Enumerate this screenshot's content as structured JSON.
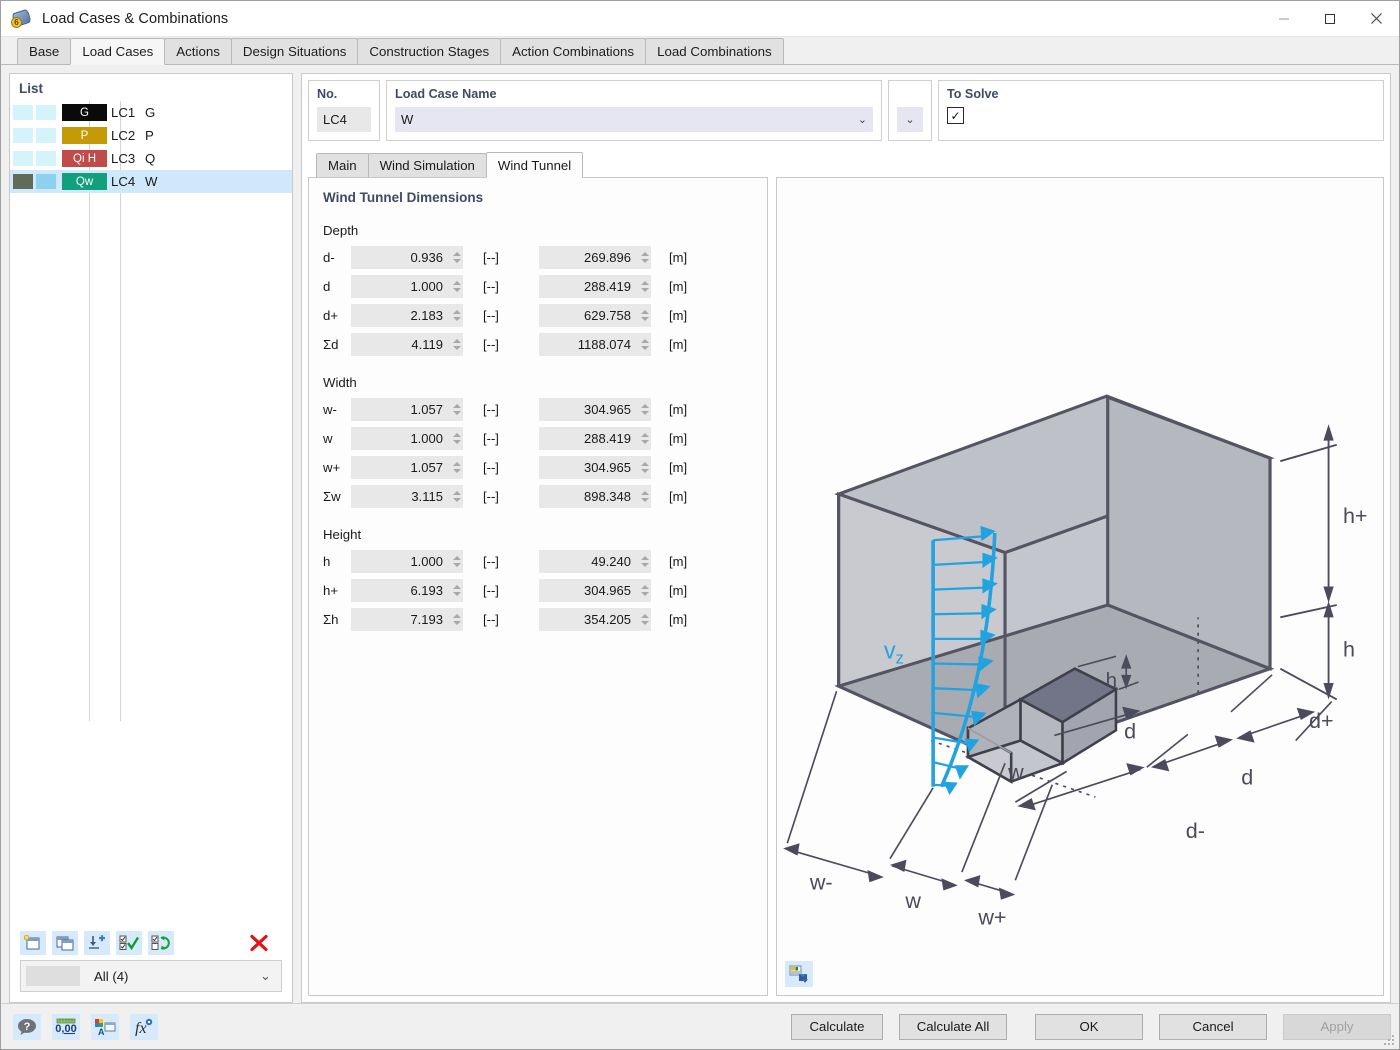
{
  "window": {
    "title": "Load Cases & Combinations",
    "icon": "load-case-icon",
    "minimize_label": "—",
    "maximize_label": "□",
    "close_label": "✕"
  },
  "tabs": [
    {
      "label": "Base",
      "active": false
    },
    {
      "label": "Load Cases",
      "active": true
    },
    {
      "label": "Actions",
      "active": false
    },
    {
      "label": "Design Situations",
      "active": false
    },
    {
      "label": "Construction Stages",
      "active": false
    },
    {
      "label": "Action Combinations",
      "active": false
    },
    {
      "label": "Load Combinations",
      "active": false
    }
  ],
  "list_panel": {
    "header": "List",
    "rows": [
      {
        "tag": "G",
        "tag_bg": "#0a0a0a",
        "no": "LC1",
        "name": "G",
        "sw1": "#d4f3fb",
        "sw2": "#d4f3fb",
        "selected": false
      },
      {
        "tag": "P",
        "tag_bg": "#c49a06",
        "no": "LC2",
        "name": "P",
        "sw1": "#d4f3fb",
        "sw2": "#d4f3fb",
        "selected": false
      },
      {
        "tag": "Qi H",
        "tag_bg": "#bf4b4b",
        "no": "LC3",
        "name": "Q",
        "sw1": "#d4f3fb",
        "sw2": "#d4f3fb",
        "selected": false
      },
      {
        "tag": "Qw",
        "tag_bg": "#12a07c",
        "no": "LC4",
        "name": "W",
        "sw1": "#606b5c",
        "sw2": "#8ed0ef",
        "selected": true
      }
    ],
    "toolbar": [
      {
        "name": "new-load-case-button",
        "title": "New"
      },
      {
        "name": "copy-load-case-button",
        "title": "Copy"
      },
      {
        "name": "import-load-case-button",
        "title": "Import"
      },
      {
        "name": "select-all-button",
        "title": "Select All"
      },
      {
        "name": "invert-selection-button",
        "title": "Invert Selection"
      },
      {
        "name": "delete-load-case-button",
        "title": "Delete"
      }
    ],
    "filter": {
      "value": "All (4)",
      "caret": "⌄"
    }
  },
  "header_fields": {
    "no": {
      "label": "No.",
      "value": "LC4"
    },
    "load_case_name": {
      "label": "Load Case Name",
      "value": "W",
      "caret": "⌄"
    },
    "mini_select": {
      "caret": "⌄"
    },
    "to_solve": {
      "label": "To Solve",
      "checked": true,
      "check_glyph": "✓"
    }
  },
  "inner_tabs": [
    {
      "label": "Main",
      "active": false
    },
    {
      "label": "Wind Simulation",
      "active": false
    },
    {
      "label": "Wind Tunnel",
      "active": true
    }
  ],
  "form": {
    "section_title": "Wind Tunnel Dimensions",
    "unit_ratio": "[--]",
    "unit_length": "[m]",
    "groups": [
      {
        "label": "Depth",
        "rows": [
          {
            "symbol": "d-",
            "ratio": "0.936",
            "length": "269.896"
          },
          {
            "symbol": "d",
            "ratio": "1.000",
            "length": "288.419"
          },
          {
            "symbol": "d+",
            "ratio": "2.183",
            "length": "629.758"
          },
          {
            "symbol": "Σd",
            "ratio": "4.119",
            "length": "1188.074"
          }
        ]
      },
      {
        "label": "Width",
        "rows": [
          {
            "symbol": "w-",
            "ratio": "1.057",
            "length": "304.965"
          },
          {
            "symbol": "w",
            "ratio": "1.000",
            "length": "288.419"
          },
          {
            "symbol": "w+",
            "ratio": "1.057",
            "length": "304.965"
          },
          {
            "symbol": "Σw",
            "ratio": "3.115",
            "length": "898.348"
          }
        ]
      },
      {
        "label": "Height",
        "rows": [
          {
            "symbol": "h",
            "ratio": "1.000",
            "length": "49.240"
          },
          {
            "symbol": "h+",
            "ratio": "6.193",
            "length": "304.965"
          },
          {
            "symbol": "Σh",
            "ratio": "7.193",
            "length": "354.205"
          }
        ]
      }
    ]
  },
  "diagram": {
    "labels": {
      "velocity": "v",
      "velocity_sub": "z",
      "h_plus": "h+",
      "h_side": "h",
      "h_building": "h",
      "d_plus": "d+",
      "d_mid": "d",
      "d_minus": "d-",
      "d_building": "d",
      "w_minus": "w-",
      "w_mid": "w",
      "w_plus": "w+",
      "w_building": "w"
    },
    "colors": {
      "edge": "#545463",
      "face_light": "#c8c9cf",
      "face_mid": "#b0b2ba",
      "face_floor": "#a9abb3",
      "arrow": "#22a3e0",
      "building_roof": "#6f7285",
      "building_side": "#9a9da8"
    },
    "export_button": "save-image-button"
  },
  "footer": {
    "icons": [
      {
        "name": "help-icon"
      },
      {
        "name": "units-icon"
      },
      {
        "name": "display-properties-icon"
      },
      {
        "name": "formula-icon"
      }
    ],
    "buttons": [
      {
        "label": "Calculate",
        "name": "calculate-button",
        "disabled": false,
        "wide": false
      },
      {
        "label": "Calculate All",
        "name": "calculate-all-button",
        "disabled": false,
        "wide": true
      },
      {
        "label": "OK",
        "name": "ok-button",
        "disabled": false,
        "wide": true
      },
      {
        "label": "Cancel",
        "name": "cancel-button",
        "disabled": false,
        "wide": true
      },
      {
        "label": "Apply",
        "name": "apply-button",
        "disabled": true,
        "wide": true
      }
    ]
  }
}
